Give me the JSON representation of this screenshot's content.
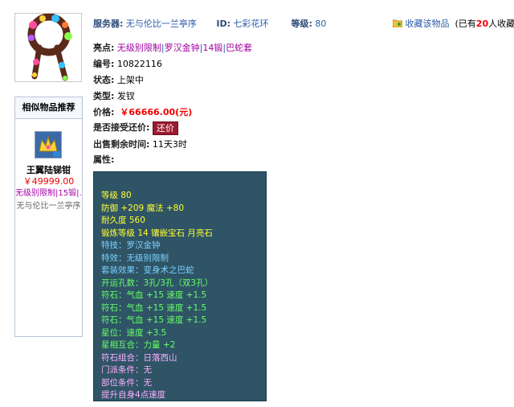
{
  "header": {
    "server_label": "服务器:",
    "server_value": "无与伦比一兰亭序",
    "id_label": "ID:",
    "id_value": "七彩花环",
    "level_label": "等级:",
    "level_value": "80",
    "favorite_label": "收藏该物品",
    "favorite_count_prefix": "(已有",
    "favorite_count": "20",
    "favorite_count_suffix": "人收藏)"
  },
  "details": {
    "highlight_label": "亮点:",
    "highlights": [
      "无级别限制",
      "罗汉金钟",
      "14锻",
      "巴蛇套"
    ],
    "highlight_sep": "|",
    "serial_label": "编号:",
    "serial_value": "10822116",
    "status_label": "状态:",
    "status_value": "上架中",
    "type_label": "类型:",
    "type_value": "发钗",
    "price_label": "价格:",
    "price_value": "￥66666.00(元)",
    "haggle_label": "是否接受还价:",
    "haggle_button": "还价",
    "time_label": "出售剩余时间:",
    "time_value": "11天3时",
    "attr_label": "属性:"
  },
  "properties": [
    {
      "text": "等级 80",
      "color": "yellow"
    },
    {
      "text": "防御 +209 魔法 +80",
      "color": "yellow"
    },
    {
      "text": "耐久度 560",
      "color": "yellow"
    },
    {
      "text": "锻炼等级 14 镶嵌宝石 月亮石",
      "color": "yellow"
    },
    {
      "text": "特技：罗汉金钟",
      "color": "blue"
    },
    {
      "text": "特效：无级别限制",
      "color": "blue"
    },
    {
      "text": "套装效果：变身术之巴蛇",
      "color": "blue"
    },
    {
      "text": "开运孔数：3孔/3孔（双3孔）",
      "color": "green"
    },
    {
      "text": "符石：气血 +15 速度 +1.5",
      "color": "green"
    },
    {
      "text": "符石：气血 +15 速度 +1.5",
      "color": "green"
    },
    {
      "text": "符石：气血 +15 速度 +1.5",
      "color": "green"
    },
    {
      "text": "星位：速度 +3.5",
      "color": "green"
    },
    {
      "text": "星相互合：力量 +2",
      "color": "green"
    },
    {
      "text": "符石组合：日落西山",
      "color": "purple"
    },
    {
      "text": "门派条件：无",
      "color": "purple"
    },
    {
      "text": "部位条件：无",
      "color": "purple"
    },
    {
      "text": "提升自身4点速度",
      "color": "purple"
    }
  ],
  "similar": {
    "title": "相似物品推荐",
    "item_name": "王翼陆锑钳",
    "item_price": "￥49999.00",
    "item_tags": "无级别限制|15锻|…",
    "item_server": "无与伦比一兰亭序"
  },
  "colors": {
    "props_bg": "#2e5466",
    "yellow": "#ffff33",
    "blue": "#7fd0ff",
    "green": "#66ff66",
    "purple": "#ffb0ff",
    "price": "#ee0000",
    "haggle_bg": "#9a1a30"
  }
}
